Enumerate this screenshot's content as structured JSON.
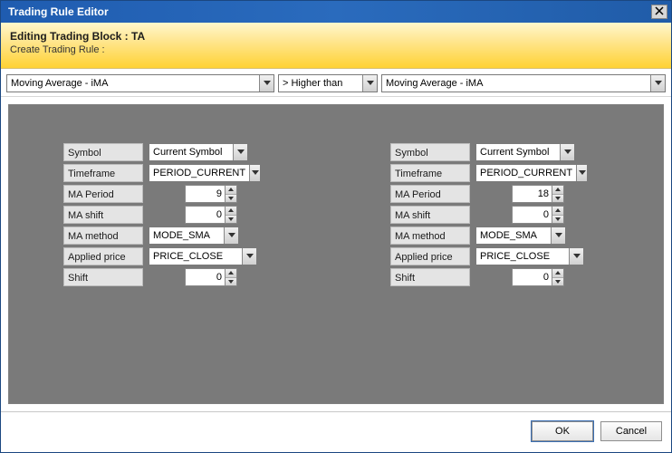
{
  "title": "Trading Rule Editor",
  "header": {
    "line1": "Editing Trading Block : TA",
    "line2": "Create Trading Rule :"
  },
  "top": {
    "left_indicator": "Moving Average - iMA",
    "comparator": "> Higher than",
    "right_indicator": "Moving Average - iMA"
  },
  "fields": {
    "symbol_label": "Symbol",
    "timeframe_label": "Timeframe",
    "ma_period_label": "MA Period",
    "ma_shift_label": "MA shift",
    "ma_method_label": "MA method",
    "applied_price_label": "Applied price",
    "shift_label": "Shift"
  },
  "left": {
    "symbol": "Current Symbol",
    "timeframe": "PERIOD_CURRENT",
    "ma_period": "9",
    "ma_shift": "0",
    "ma_method": "MODE_SMA",
    "applied_price": "PRICE_CLOSE",
    "shift": "0"
  },
  "right": {
    "symbol": "Current Symbol",
    "timeframe": "PERIOD_CURRENT",
    "ma_period": "18",
    "ma_shift": "0",
    "ma_method": "MODE_SMA",
    "applied_price": "PRICE_CLOSE",
    "shift": "0"
  },
  "footer": {
    "ok": "OK",
    "cancel": "Cancel"
  }
}
